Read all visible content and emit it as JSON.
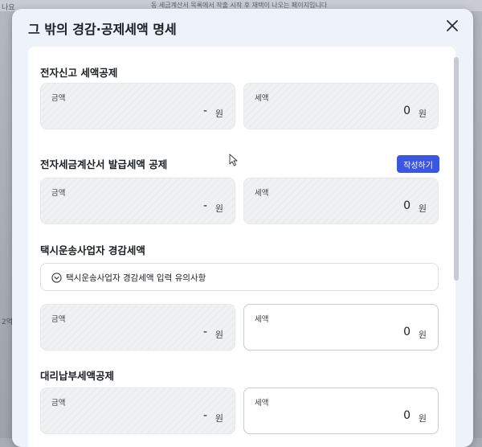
{
  "background": {
    "banner_text": "동 세금계산서 목록에서 작출 시작 후 채택이 나오는 페이지입니다",
    "left_label_top": "나요",
    "left_label_bottom": "2억"
  },
  "modal": {
    "title": "그 밖의 경감·공제세액 명세",
    "close_icon": "close-icon",
    "accent_color": "#3b56e0"
  },
  "sections": {
    "e_filing": {
      "title": "전자신고 세액공제",
      "amount_label": "금액",
      "amount_value": "-",
      "amount_unit": "원",
      "tax_label": "세액",
      "tax_value": "0",
      "tax_unit": "원"
    },
    "e_invoice": {
      "title": "전자세금계산서 발급세액 공제",
      "button_label": "작성하기",
      "amount_label": "금액",
      "amount_value": "-",
      "amount_unit": "원",
      "tax_label": "세액",
      "tax_value": "0",
      "tax_unit": "원"
    },
    "taxi": {
      "title": "택시운송사업자 경감세액",
      "notice": "택시운송사업자 경감세액 입력 유의사항",
      "notice_icon": "chevron-down-circle-icon",
      "amount_label": "금액",
      "amount_value": "-",
      "amount_unit": "원",
      "tax_label": "세액",
      "tax_value": "0",
      "tax_unit": "원"
    },
    "proxy": {
      "title": "대리납부세액공제",
      "amount_label": "금액",
      "amount_value": "-",
      "amount_unit": "원",
      "tax_label": "세액",
      "tax_value": "0",
      "tax_unit": "원"
    }
  }
}
